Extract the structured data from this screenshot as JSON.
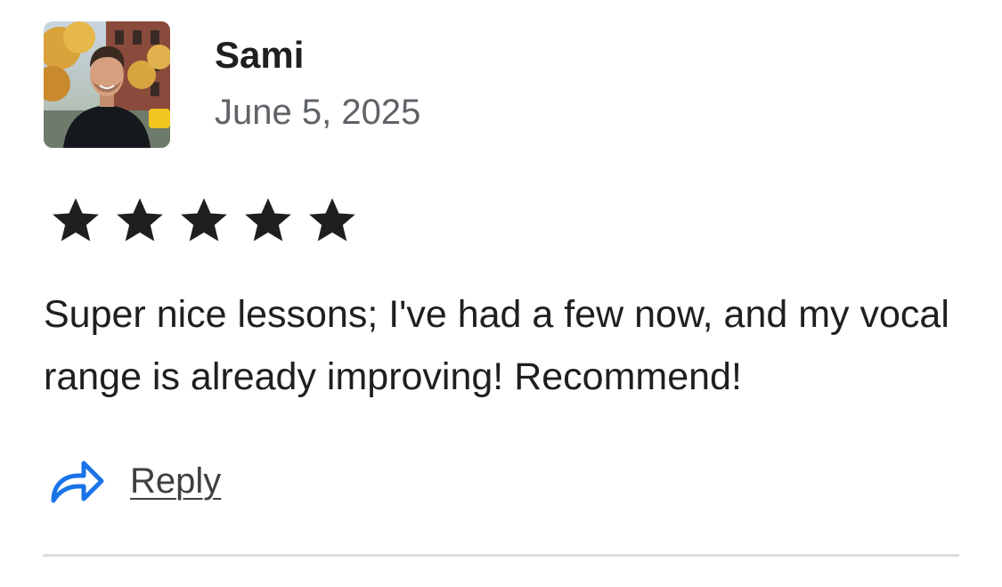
{
  "review": {
    "reviewer_name": "Sami",
    "date": "June 5, 2025",
    "rating": 5,
    "rating_max": 5,
    "text": "Super nice lessons; I've had a few now, and my vocal range is already improving! Recommend!",
    "reply_label": "Reply"
  },
  "icons": {
    "avatar": "reviewer-photo",
    "star": "star-icon",
    "reply": "reply-arrow-icon"
  },
  "colors": {
    "text": "#1f1f1f",
    "muted": "#5f6368",
    "star": "#1f1f1f",
    "reply_icon": "#1a73e8",
    "divider": "#dadce0"
  }
}
